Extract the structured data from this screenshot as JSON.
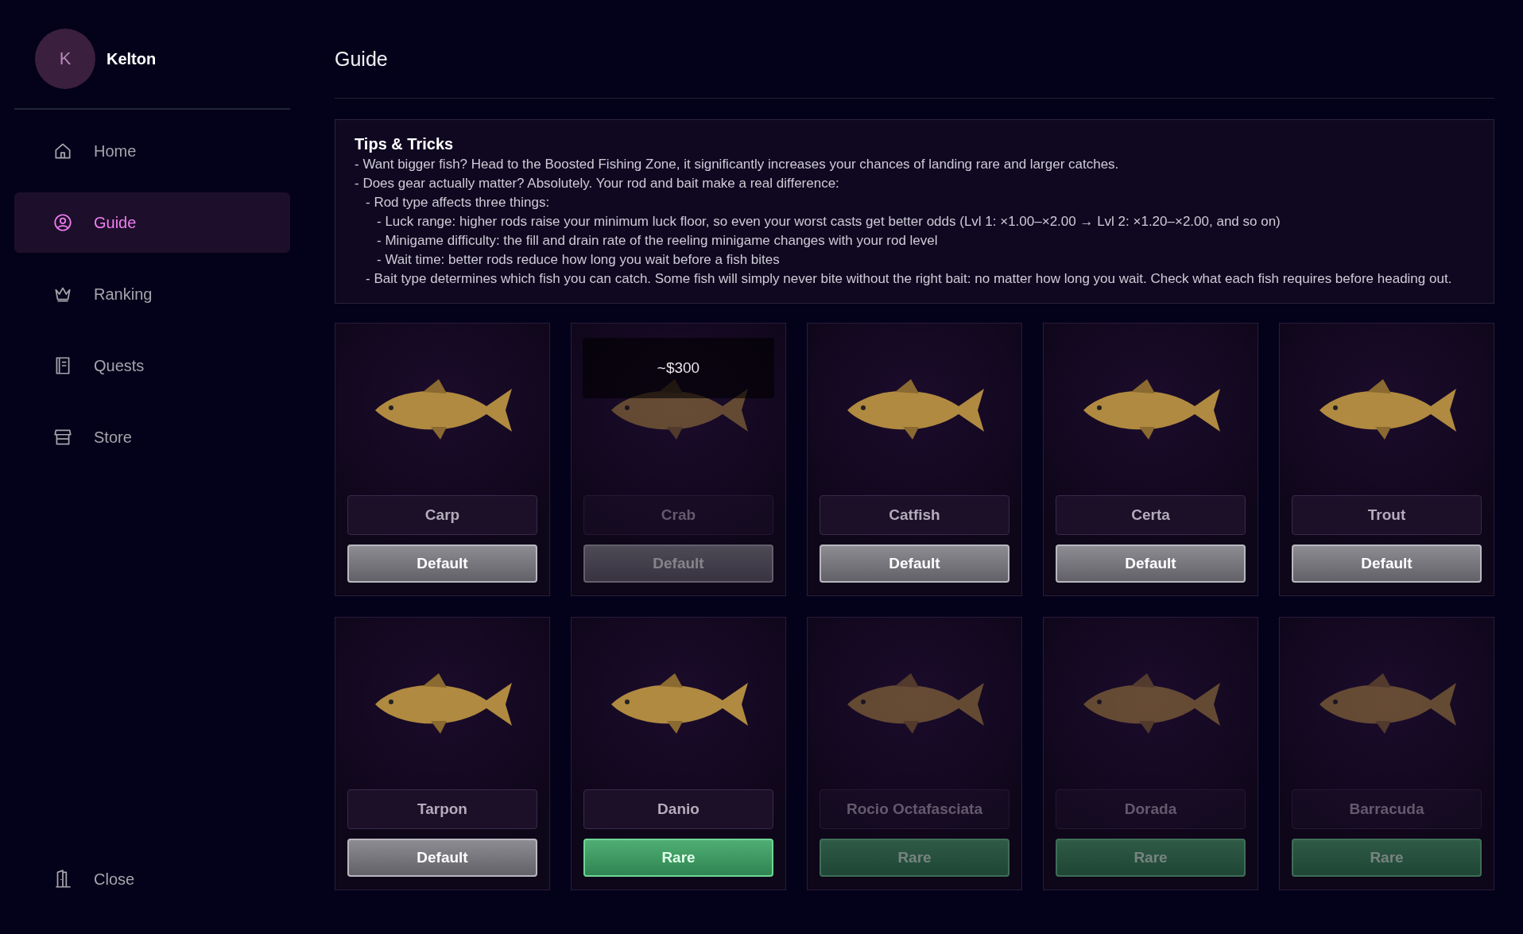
{
  "user": {
    "initial": "K",
    "name": "Kelton"
  },
  "nav": [
    {
      "kind": "home",
      "label": "Home",
      "selected": false
    },
    {
      "kind": "guide",
      "label": "Guide",
      "selected": true
    },
    {
      "kind": "ranking",
      "label": "Ranking",
      "selected": false
    },
    {
      "kind": "quests",
      "label": "Quests",
      "selected": false
    },
    {
      "kind": "store",
      "label": "Store",
      "selected": false
    }
  ],
  "close": {
    "label": "Close"
  },
  "page_title": "Guide",
  "tips": {
    "title": "Tips & Tricks",
    "items": [
      {
        "text": "- Want bigger fish? Head to the Boosted Fishing Zone, it significantly increases your chances of landing rare and larger catches."
      },
      {
        "text": "- Does gear actually matter? Absolutely. Your rod and bait make a real difference:",
        "children": [
          {
            "text": "- Rod type affects three things:",
            "children": [
              {
                "text": "- Luck range: higher rods raise your minimum luck floor, so even your worst casts get better odds (Lvl 1: ×1.00–×2.00 → Lvl 2: ×1.20–×2.00, and so on)"
              },
              {
                "text": "- Minigame difficulty: the fill and drain rate of the reeling minigame changes with your rod level"
              },
              {
                "text": "- Wait time: better rods reduce how long you wait before a fish bites"
              }
            ]
          },
          {
            "text": "- Bait type determines which fish you can catch. Some fish will simply never bite without the right bait: no matter how long you wait. Check what each fish requires before heading out."
          }
        ]
      }
    ]
  },
  "fish": [
    {
      "name": "Carp",
      "disabled": false,
      "button": {
        "kind": "default",
        "label": "Default"
      }
    },
    {
      "name": "Crab",
      "disabled": true,
      "hovered": true,
      "price": "~$300",
      "button": {
        "kind": "default",
        "label": "Default"
      }
    },
    {
      "name": "Catfish",
      "disabled": false,
      "button": {
        "kind": "default",
        "label": "Default"
      }
    },
    {
      "name": "Certa",
      "disabled": false,
      "button": {
        "kind": "default",
        "label": "Default"
      }
    },
    {
      "name": "Trout",
      "disabled": false,
      "button": {
        "kind": "default",
        "label": "Default"
      }
    },
    {
      "name": "Tarpon",
      "disabled": false,
      "button": {
        "kind": "default",
        "label": "Default"
      }
    },
    {
      "name": "Danio",
      "disabled": false,
      "button": {
        "kind": "rare",
        "label": "Rare"
      }
    },
    {
      "name": "Rocio Octafasciata",
      "disabled": true,
      "button": {
        "kind": "rare",
        "label": "Rare"
      }
    },
    {
      "name": "Dorada",
      "disabled": true,
      "button": {
        "kind": "rare",
        "label": "Rare"
      }
    },
    {
      "name": "Barracuda",
      "disabled": true,
      "button": {
        "kind": "rare",
        "label": "Rare"
      }
    }
  ]
}
